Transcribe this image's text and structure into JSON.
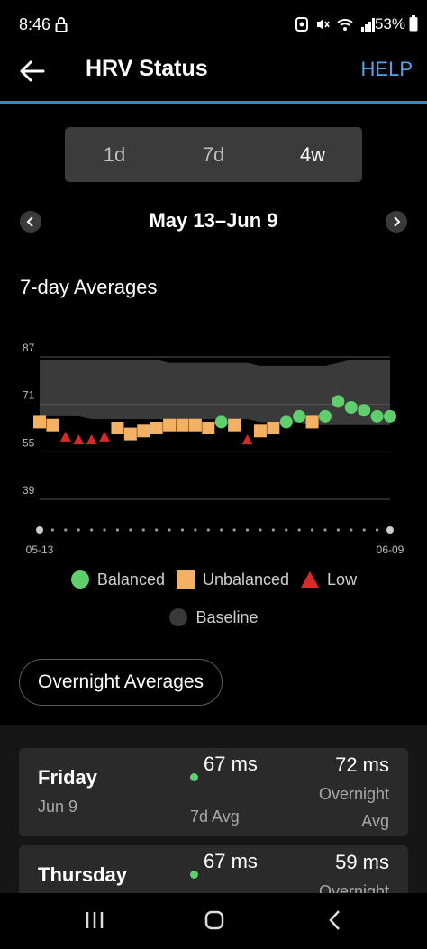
{
  "status_bar": {
    "time": "8:46",
    "battery": "53%"
  },
  "app_bar": {
    "title": "HRV Status",
    "help": "HELP"
  },
  "range_tabs": [
    {
      "label": "1d",
      "active": false
    },
    {
      "label": "7d",
      "active": false
    },
    {
      "label": "4w",
      "active": true
    }
  ],
  "date_range": "May 13–Jun 9",
  "chart_section_title": "7-day Averages",
  "chart_data": {
    "type": "scatter",
    "title": "",
    "xlabel": "",
    "ylabel": "",
    "yticks": [
      87,
      71,
      55,
      39
    ],
    "ylim": [
      39,
      87
    ],
    "x_start_label": "05-13",
    "x_end_label": "06-09",
    "baseline_band": {
      "name": "Baseline",
      "upper": [
        86,
        86,
        86,
        86,
        86,
        86,
        86,
        86,
        86,
        86,
        85,
        85,
        85,
        85,
        85,
        85,
        85,
        84,
        84,
        84,
        84,
        84,
        84,
        85,
        86,
        86,
        86,
        86
      ],
      "lower": [
        67,
        67,
        67,
        67,
        66,
        66,
        66,
        66,
        66,
        66,
        66,
        66,
        66,
        66,
        66,
        66,
        66,
        65,
        65,
        65,
        65,
        64,
        64,
        64,
        64,
        64,
        64,
        64
      ]
    },
    "points": [
      {
        "value": 65,
        "status": "unbalanced"
      },
      {
        "value": 64,
        "status": "unbalanced"
      },
      {
        "value": 60,
        "status": "low"
      },
      {
        "value": 59,
        "status": "low"
      },
      {
        "value": 59,
        "status": "low"
      },
      {
        "value": 60,
        "status": "low"
      },
      {
        "value": 63,
        "status": "unbalanced"
      },
      {
        "value": 61,
        "status": "unbalanced"
      },
      {
        "value": 62,
        "status": "unbalanced"
      },
      {
        "value": 63,
        "status": "unbalanced"
      },
      {
        "value": 64,
        "status": "unbalanced"
      },
      {
        "value": 64,
        "status": "unbalanced"
      },
      {
        "value": 64,
        "status": "unbalanced"
      },
      {
        "value": 63,
        "status": "unbalanced"
      },
      {
        "value": 65,
        "status": "balanced"
      },
      {
        "value": 64,
        "status": "unbalanced"
      },
      {
        "value": 59,
        "status": "low"
      },
      {
        "value": 62,
        "status": "unbalanced"
      },
      {
        "value": 63,
        "status": "unbalanced"
      },
      {
        "value": 65,
        "status": "balanced"
      },
      {
        "value": 67,
        "status": "balanced"
      },
      {
        "value": 65,
        "status": "unbalanced"
      },
      {
        "value": 67,
        "status": "balanced"
      },
      {
        "value": 72,
        "status": "balanced"
      },
      {
        "value": 70,
        "status": "balanced"
      },
      {
        "value": 69,
        "status": "balanced"
      },
      {
        "value": 67,
        "status": "balanced"
      },
      {
        "value": 67,
        "status": "balanced"
      }
    ],
    "colors": {
      "balanced": "#5fcf6e",
      "unbalanced": "#f5b163",
      "low": "#d82a2a",
      "baseline": "#3a3a3a"
    }
  },
  "legend": {
    "balanced": "Balanced",
    "unbalanced": "Unbalanced",
    "low": "Low",
    "baseline": "Baseline"
  },
  "overnight_button": "Overnight Averages",
  "days": [
    {
      "name": "Friday",
      "date": "Jun 9",
      "avg": "67 ms",
      "avg_label": "7d Avg",
      "overnight": "72 ms",
      "overnight_label": "Overnight Avg"
    },
    {
      "name": "Thursday",
      "date": "",
      "avg": "67 ms",
      "avg_label": "",
      "overnight": "59 ms",
      "overnight_label": "Overnight"
    }
  ]
}
